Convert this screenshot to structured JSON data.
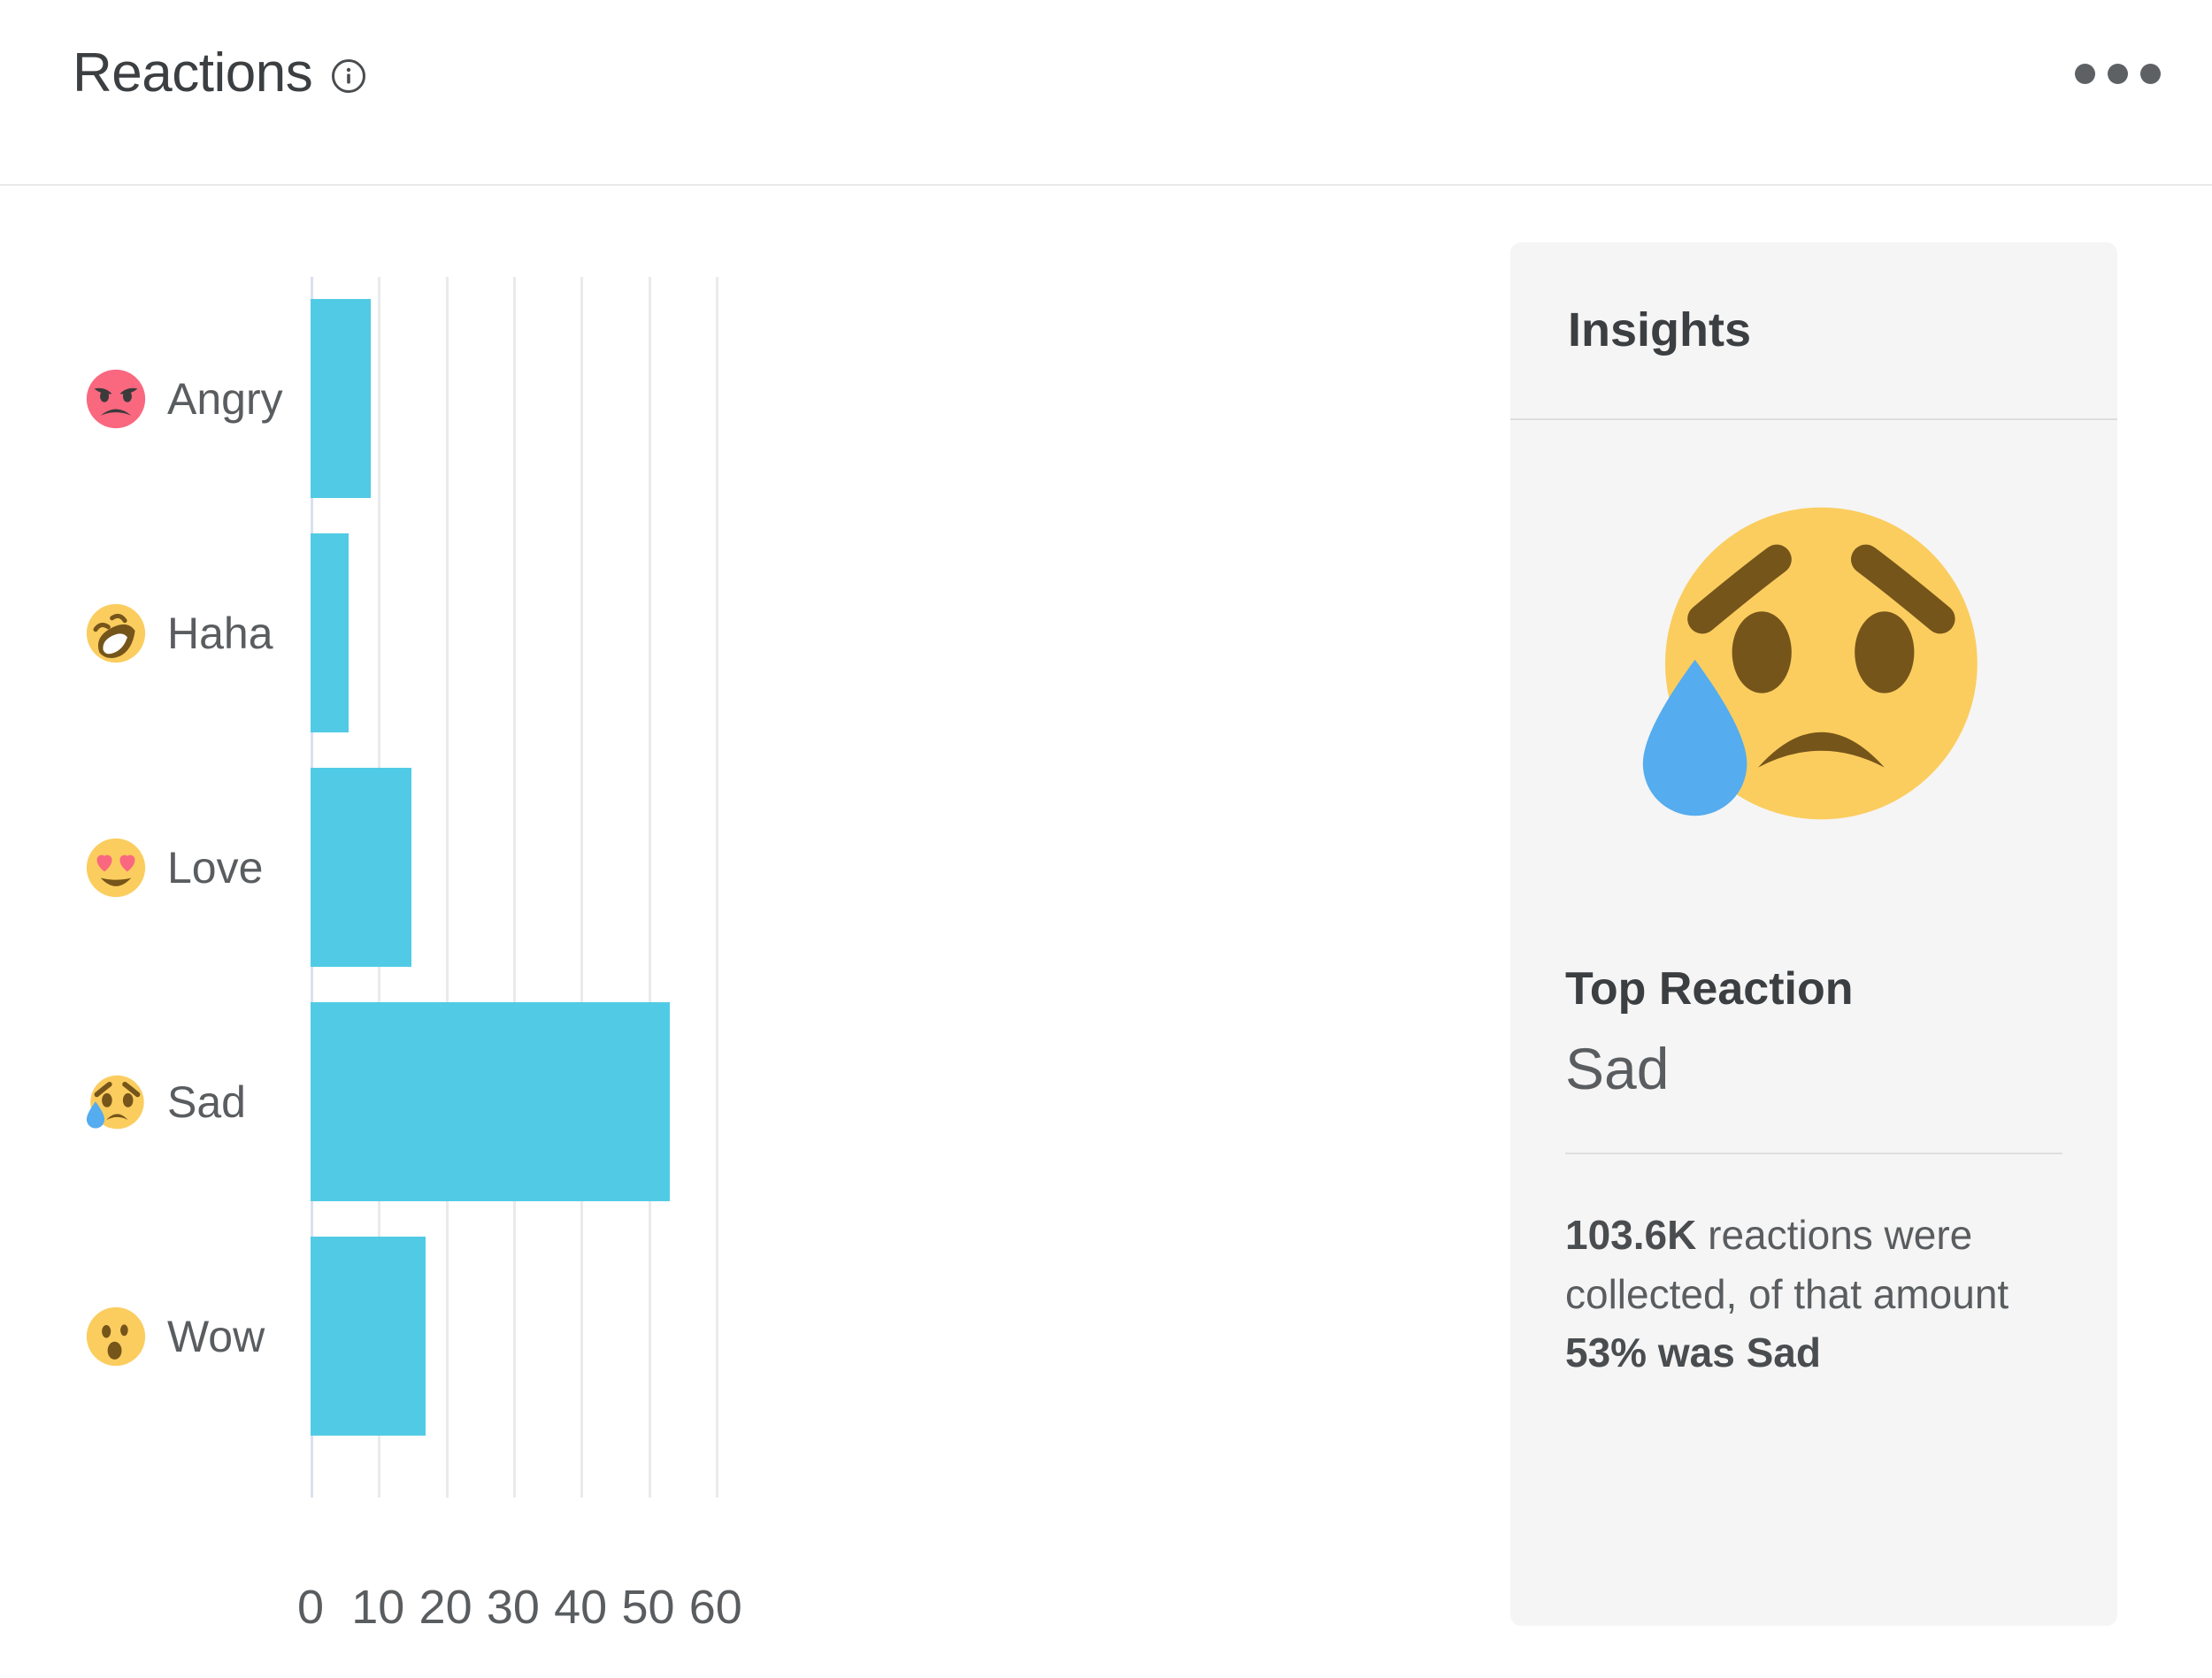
{
  "header": {
    "title": "Reactions",
    "info_icon": "info-icon",
    "menu_icon": "kebab-menu-icon"
  },
  "insights": {
    "title": "Insights",
    "featured_emoji": "sad-face-emoji",
    "top_reaction_label": "Top Reaction",
    "top_reaction_value": "Sad",
    "summary": {
      "count": "103.6K",
      "mid_text": " reactions were collected, of that amount ",
      "highlight": "53% was Sad"
    }
  },
  "chart_data": {
    "type": "bar",
    "orientation": "horizontal",
    "title": "Reactions",
    "xlabel": "",
    "ylabel": "",
    "categories": [
      "Angry",
      "Haha",
      "Love",
      "Sad",
      "Wow"
    ],
    "values": [
      8.9,
      5.7,
      14.9,
      53.2,
      17.0
    ],
    "emojis": [
      "angry-face-emoji",
      "rofl-face-emoji",
      "heart-eyes-emoji",
      "sad-face-emoji",
      "wow-face-emoji"
    ],
    "xlim": [
      0,
      60
    ],
    "xticks": [
      0,
      10,
      20,
      30,
      40,
      50,
      60
    ],
    "xtick_labels": [
      "0",
      "10",
      "20",
      "30",
      "40",
      "50",
      "60"
    ],
    "grid": true,
    "legend": false,
    "bar_color": "#51cbe5",
    "gridline_color": "#e9eaec",
    "axis_color": "#d9e0ef"
  }
}
